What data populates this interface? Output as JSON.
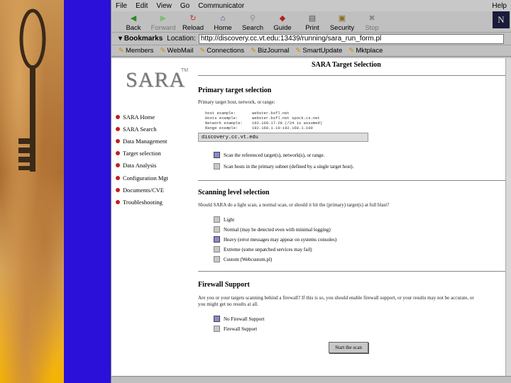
{
  "slide": {
    "accent_left": "#c89250",
    "accent_blue": "#2a10d8",
    "accent_gold": "#f5b400"
  },
  "browser": {
    "menu": [
      "File",
      "Edit",
      "View",
      "Go",
      "Communicator"
    ],
    "help": "Help",
    "toolbar": [
      {
        "label": "Back",
        "icon": "back-arrow-icon",
        "glyph": "◀",
        "enabled": true
      },
      {
        "label": "Forward",
        "icon": "forward-arrow-icon",
        "glyph": "▶",
        "enabled": false
      },
      {
        "label": "Reload",
        "icon": "reload-icon",
        "glyph": "↻",
        "enabled": true
      },
      {
        "label": "Home",
        "icon": "home-icon",
        "glyph": "⌂",
        "enabled": true
      },
      {
        "label": "Search",
        "icon": "search-icon",
        "glyph": "⚲",
        "enabled": true
      },
      {
        "label": "Guide",
        "icon": "guide-icon",
        "glyph": "◆",
        "enabled": true
      },
      {
        "label": "Print",
        "icon": "print-icon",
        "glyph": "▤",
        "enabled": true
      },
      {
        "label": "Security",
        "icon": "security-lock-icon",
        "glyph": "▣",
        "enabled": true
      },
      {
        "label": "Stop",
        "icon": "stop-icon",
        "glyph": "✖",
        "enabled": false
      }
    ],
    "logo": "N",
    "bookmarks": "Bookmarks",
    "location_label": "Location:",
    "url": "http://discovery.cc.vt.edu:13439/running/sara_run_form.pl",
    "personal_toolbar": [
      "Members",
      "WebMail",
      "Connections",
      "BizJournal",
      "SmartUpdate",
      "Mktplace"
    ]
  },
  "sara": {
    "logo": "SARA",
    "tm": "TM",
    "nav": [
      "SARA Home",
      "SARA Search",
      "Data Management",
      "Target selection",
      "Data Analysis",
      "Configuration Mgt",
      "Documents/CVE",
      "Troubleshooting"
    ],
    "page_title": "SARA Target Selection",
    "primary": {
      "title": "Primary target selection",
      "hint": "Primary target host, network, or range:",
      "examples": "host example:       webster.bsfl.net\nHosts example:      webster.bsfl.net spock.cs.net\nNetwork example:    192.168.17.28 (/24 is assumed)\nRange example:      192.168.1.10-192.168.1.100",
      "value": "discovery.cc.vt.edu",
      "options": [
        {
          "label": "Scan the referenced target(s), network(s), or range.",
          "checked": true
        },
        {
          "label": "Scan hosts in the primary subnet (defined by a single target host).",
          "checked": false
        }
      ]
    },
    "scanning": {
      "title": "Scanning level selection",
      "hint": "Should SARA do a light scan, a normal scan, or should it hit the (primary) target(s) at full blast?",
      "options": [
        {
          "label": "Light",
          "checked": false
        },
        {
          "label": "Normal (may be detected even with minimal logging)",
          "checked": false
        },
        {
          "label": "Heavy (error messages may appear on systems consoles)",
          "checked": true
        },
        {
          "label": "Extreme (some unpatched services may fail)",
          "checked": false
        },
        {
          "label": "Custom (Webcustom.pl)",
          "checked": false
        }
      ]
    },
    "firewall": {
      "title": "Firewall Support",
      "hint_line1": "Are you or your targets scanning behind a firewall? If this is so, you should enable firewall support, or your results may not be accurate, or",
      "hint_line2": "you might get no results at all.",
      "options": [
        {
          "label": "No Firewall Support",
          "checked": true
        },
        {
          "label": "Firewall Support",
          "checked": false
        }
      ]
    },
    "submit": "Start the scan"
  }
}
